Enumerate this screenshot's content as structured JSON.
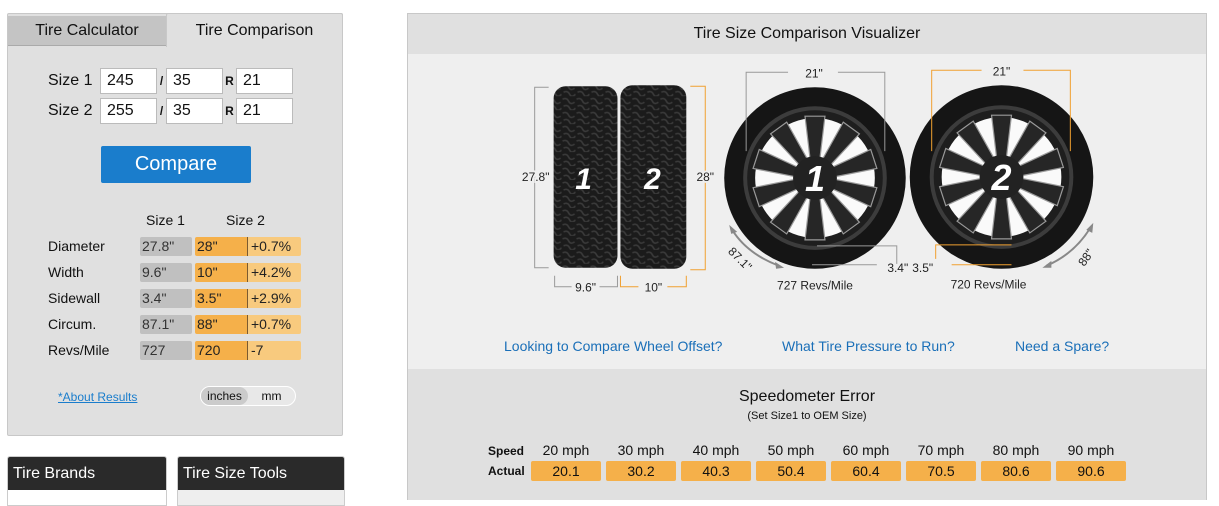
{
  "tabs": [
    {
      "label": "Tire Calculator",
      "active": false
    },
    {
      "label": "Tire Comparison",
      "active": true
    }
  ],
  "inputs": {
    "size1": {
      "label": "Size 1",
      "width": "245",
      "aspect": "35",
      "rim": "21"
    },
    "size2": {
      "label": "Size 2",
      "width": "255",
      "aspect": "35",
      "rim": "21"
    },
    "slash": "/",
    "r": "R"
  },
  "compare_label": "Compare",
  "results": {
    "headers": [
      "Size 1",
      "Size 2"
    ],
    "rows": [
      {
        "label": "Diameter",
        "size1": "27.8\"",
        "size2": "28\"",
        "diff": "+0.7%"
      },
      {
        "label": "Width",
        "size1": "9.6\"",
        "size2": "10\"",
        "diff": "+4.2%"
      },
      {
        "label": "Sidewall",
        "size1": "3.4\"",
        "size2": "3.5\"",
        "diff": "+2.9%"
      },
      {
        "label": "Circum.",
        "size1": "87.1\"",
        "size2": "88\"",
        "diff": "+0.7%"
      },
      {
        "label": "Revs/Mile",
        "size1": "727",
        "size2": "720",
        "diff": "-7"
      }
    ]
  },
  "about_link": "*About Results",
  "units": {
    "options": [
      "inches",
      "mm"
    ],
    "selected": "inches"
  },
  "panels": {
    "brands": "Tire Brands",
    "tools": "Tire Size Tools"
  },
  "visualizer": {
    "title": "Tire Size Comparison Visualizer",
    "tread": {
      "tire1": {
        "number": "1",
        "height": "27.8\"",
        "width": "9.6\""
      },
      "tire2": {
        "number": "2",
        "height": "28\"",
        "width": "10\""
      }
    },
    "wheels": {
      "wheel1": {
        "number": "1",
        "rim": "21\"",
        "sidewall": "3.4\"",
        "circum": "87.1\"",
        "revs": "727 Revs/Mile"
      },
      "wheel2": {
        "number": "2",
        "rim": "21\"",
        "sidewall": "3.5\"",
        "circum": "88\"",
        "revs": "720 Revs/Mile"
      }
    },
    "colors": {
      "size1": "#9a9a9a",
      "size2": "#f0a030"
    }
  },
  "links": [
    "Looking to Compare Wheel Offset?",
    "What Tire Pressure to Run?",
    "Need a Spare?"
  ],
  "speedometer": {
    "title": "Speedometer Error",
    "subtitle": "(Set Size1 to OEM Size)",
    "speed_label": "Speed",
    "actual_label": "Actual",
    "speeds": [
      "20 mph",
      "30 mph",
      "40 mph",
      "50 mph",
      "60 mph",
      "70 mph",
      "80 mph",
      "90 mph"
    ],
    "actual": [
      "20.1",
      "30.2",
      "40.3",
      "50.4",
      "60.4",
      "70.5",
      "80.6",
      "90.6"
    ]
  }
}
